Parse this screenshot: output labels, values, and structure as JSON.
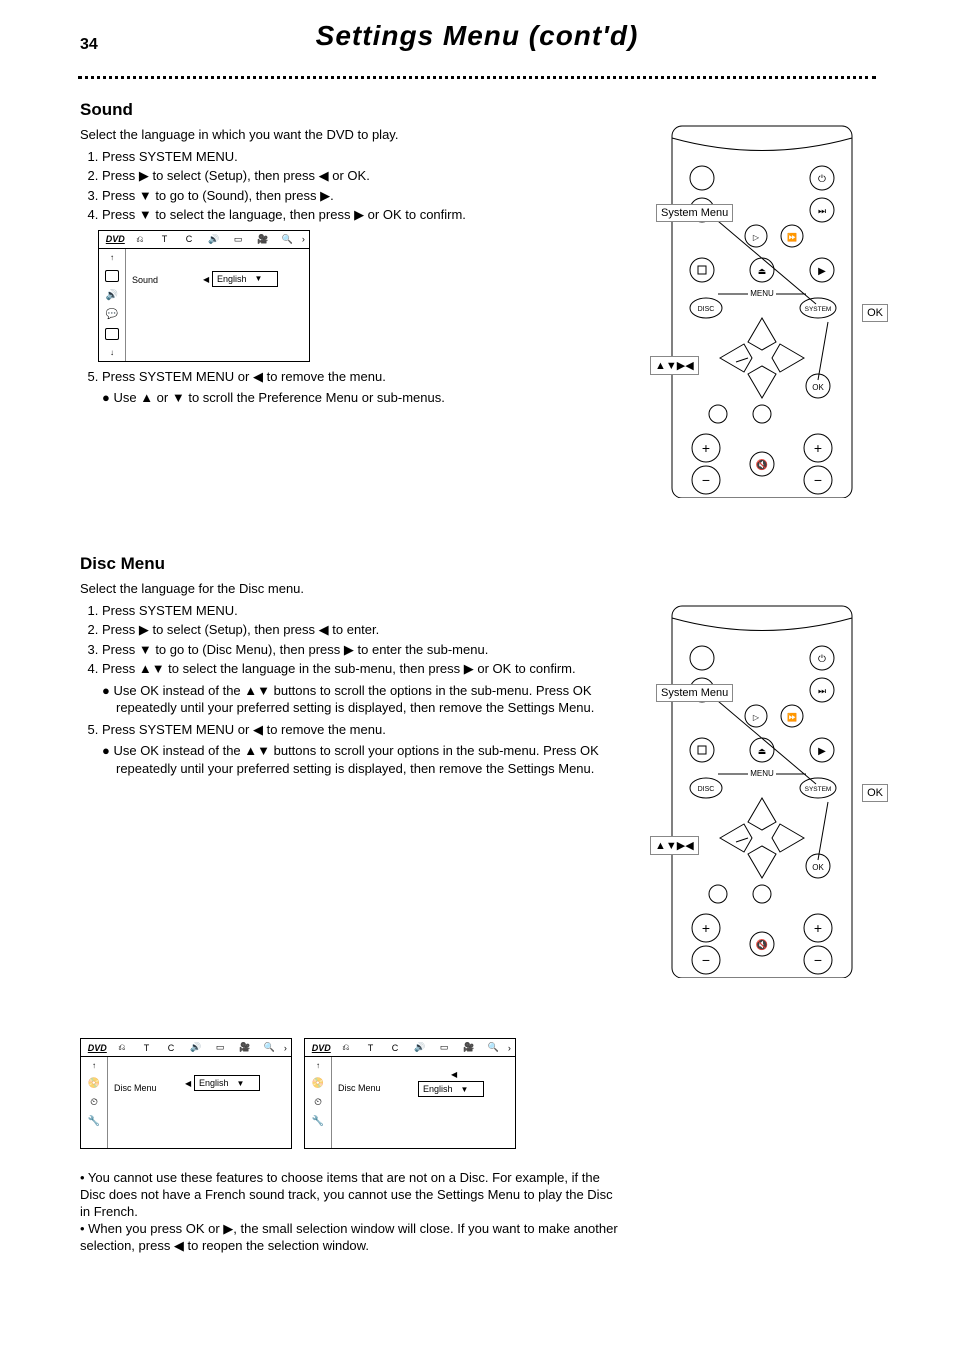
{
  "page_number": "34",
  "page_title": "Settings Menu (cont'd)",
  "sound": {
    "heading": "Sound",
    "intro": "Select the language in which you want the DVD to play.",
    "steps": [
      "Press SYSTEM MENU.",
      "Press ▶ to select     (Setup), then press ◀ or OK.",
      "Press ▼ to go to      (Sound), then press ▶.",
      "Press ▼ to select the language, then press ▶ or OK to confirm.",
      "Press SYSTEM MENU or ◀ to remove the menu.",
      "Use ▲ or ▼ to scroll the Preference Menu or sub-menus."
    ]
  },
  "disc_menu": {
    "heading": "Disc Menu",
    "intro": "Select the language for the Disc menu.",
    "steps": [
      "Press SYSTEM MENU.",
      "Press ▶ to select     (Setup), then press ◀ to enter.",
      "Press ▼ to go to      (Disc Menu), then press ▶ to enter the sub-menu.",
      "Press ▲▼ to select the language in the sub-menu, then press ▶ or OK to confirm.",
      "Use OK instead of the ▲▼ buttons to scroll the options in the sub-menu. Press OK repeatedly until your preferred setting is displayed, then remove the Settings Menu.",
      "Press SYSTEM MENU or ◀ to remove the menu.",
      "Use OK instead of the ▲▼ buttons to scroll your options in the sub-menu. Press OK repeatedly until your preferred setting is displayed, then remove the Settings Menu."
    ]
  },
  "note_block": "• You cannot use these features to choose items that are not on a Disc. For example, if the Disc does not have a French sound track, you cannot use the Settings Menu to play the Disc in French.\n• When you press OK or ▶, the small selection window will close. If you want to make another selection, press ◀ to reopen the selection window.",
  "remote": {
    "labels": {
      "system_menu": "System Menu",
      "ok": "OK",
      "arrows": "▲▼▶◀",
      "menu": "MENU",
      "disc": "DISC",
      "system": "SYSTEM"
    }
  },
  "submenu": {
    "icon_row": [
      "T",
      "C"
    ],
    "dvd": "DVD",
    "sound": {
      "label": "Sound",
      "value": "English"
    },
    "disc_menu": {
      "label": "Disc Menu",
      "value": "English"
    }
  },
  "icons": {
    "setup": "setup-icon",
    "sound": "sound-icon",
    "disc_menu": "disc-menu-icon"
  }
}
